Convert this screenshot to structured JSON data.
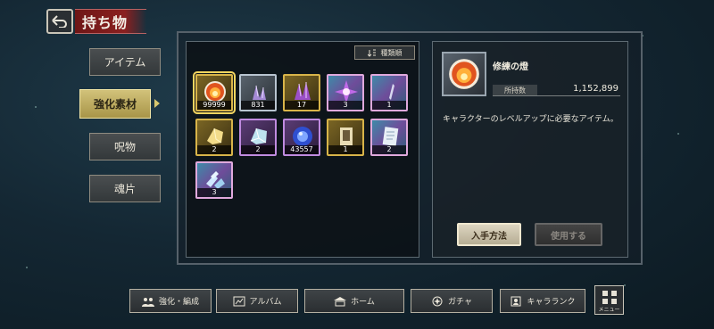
{
  "header": {
    "title": "持ち物"
  },
  "tabs": [
    {
      "label": "アイテム",
      "active": false
    },
    {
      "label": "強化素材",
      "active": true
    },
    {
      "label": "呪物",
      "active": false
    },
    {
      "label": "魂片",
      "active": false
    }
  ],
  "sort": {
    "label": "種類順"
  },
  "items": [
    {
      "name": "修練の燈",
      "count": "99999",
      "rarity": "gold",
      "icon": "flame-orb-icon",
      "selected": true
    },
    {
      "name": "",
      "count": "831",
      "rarity": "silver",
      "icon": "purple-crystal-icon"
    },
    {
      "name": "",
      "count": "17",
      "rarity": "gold",
      "icon": "purple-crystal-icon"
    },
    {
      "name": "",
      "count": "3",
      "rarity": "rainbow",
      "icon": "purple-crystal-icon"
    },
    {
      "name": "",
      "count": "1",
      "rarity": "rainbow",
      "icon": "shard-icon"
    },
    {
      "name": "",
      "count": "2",
      "rarity": "gold",
      "icon": "gold-stone-icon"
    },
    {
      "name": "",
      "count": "2",
      "rarity": "purple",
      "icon": "rainbow-stone-icon"
    },
    {
      "name": "",
      "count": "43557",
      "rarity": "purple",
      "icon": "blue-orb-icon"
    },
    {
      "name": "",
      "count": "1",
      "rarity": "gold",
      "icon": "scroll-icon"
    },
    {
      "name": "",
      "count": "2",
      "rarity": "rainbow",
      "icon": "scroll-icon"
    },
    {
      "name": "",
      "count": "3",
      "rarity": "rainbow",
      "icon": "shard-pile-icon"
    }
  ],
  "detail": {
    "name": "修練の燈",
    "owned_label": "所持数",
    "owned_value": "1,152,899",
    "description": "キャラクターのレベルアップに必要なアイテム。",
    "acquire_label": "入手方法",
    "use_label": "使用する"
  },
  "nav": [
    {
      "label": "強化・編成",
      "icon": "party-icon"
    },
    {
      "label": "アルバム",
      "icon": "album-icon"
    },
    {
      "label": "ホーム",
      "icon": "home-icon"
    },
    {
      "label": "ガチャ",
      "icon": "gacha-icon"
    },
    {
      "label": "キャラランク",
      "icon": "rank-icon"
    }
  ],
  "menu": {
    "label": "メニュー"
  },
  "colors": {
    "accent": "#d8c76e",
    "title_bg": "#7a1a1a",
    "panel": "#142733"
  }
}
